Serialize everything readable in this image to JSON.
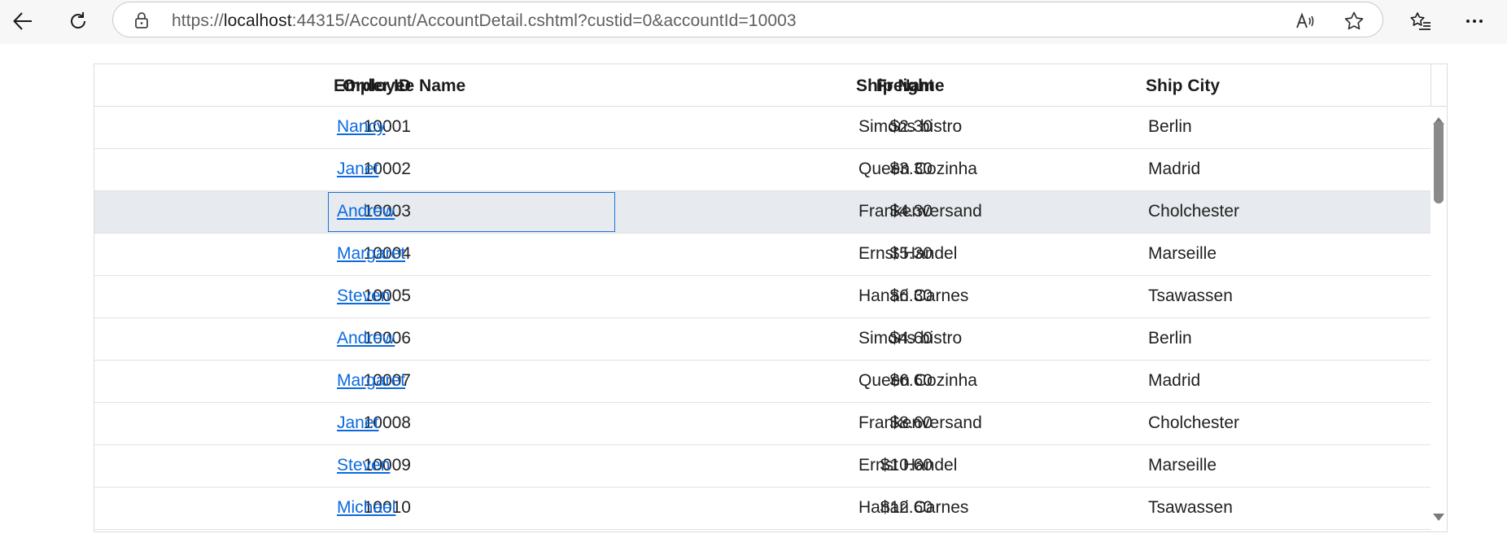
{
  "browser": {
    "url_prefix": "https://",
    "url_host": "localhost",
    "url_rest": ":44315/Account/AccountDetail.cshtml?custid=0&accountId=10003",
    "icons": [
      "back-arrow-icon",
      "refresh-icon",
      "lock-icon",
      "read-aloud-icon",
      "favorite-star-icon",
      "favorites-list-icon",
      "more-menu-icon"
    ]
  },
  "grid": {
    "columns": {
      "order_id": "Order ID",
      "employee_name": "Employee Name",
      "freight": "Freight",
      "ship_name": "Ship Name",
      "ship_city": "Ship City"
    },
    "selected_order_id": "10003",
    "rows": [
      {
        "order_id": "10001",
        "employee": "Nancy",
        "freight": "$2.30",
        "ship_name": "Simons bistro",
        "ship_city": "Berlin"
      },
      {
        "order_id": "10002",
        "employee": "Janet",
        "freight": "$3.30",
        "ship_name": "Queen Cozinha",
        "ship_city": "Madrid"
      },
      {
        "order_id": "10003",
        "employee": "Andrew",
        "freight": "$4.30",
        "ship_name": "Frankenversand",
        "ship_city": "Cholchester"
      },
      {
        "order_id": "10004",
        "employee": "Margaret",
        "freight": "$5.30",
        "ship_name": "Ernst Handel",
        "ship_city": "Marseille"
      },
      {
        "order_id": "10005",
        "employee": "Steven",
        "freight": "$6.30",
        "ship_name": "Hanari Carnes",
        "ship_city": "Tsawassen"
      },
      {
        "order_id": "10006",
        "employee": "Andrew",
        "freight": "$4.60",
        "ship_name": "Simons bistro",
        "ship_city": "Berlin"
      },
      {
        "order_id": "10007",
        "employee": "Margaret",
        "freight": "$6.60",
        "ship_name": "Queen Cozinha",
        "ship_city": "Madrid"
      },
      {
        "order_id": "10008",
        "employee": "Janet",
        "freight": "$8.60",
        "ship_name": "Frankenversand",
        "ship_city": "Cholchester"
      },
      {
        "order_id": "10009",
        "employee": "Steven",
        "freight": "$10.60",
        "ship_name": "Ernst Handel",
        "ship_city": "Marseille"
      },
      {
        "order_id": "10010",
        "employee": "Michael",
        "freight": "$12.60",
        "ship_name": "Hanari Carnes",
        "ship_city": "Tsawassen"
      }
    ]
  },
  "colors": {
    "link": "#0b6adf",
    "selected_row": "#e7eaee",
    "focus_border": "#1a73d9"
  }
}
